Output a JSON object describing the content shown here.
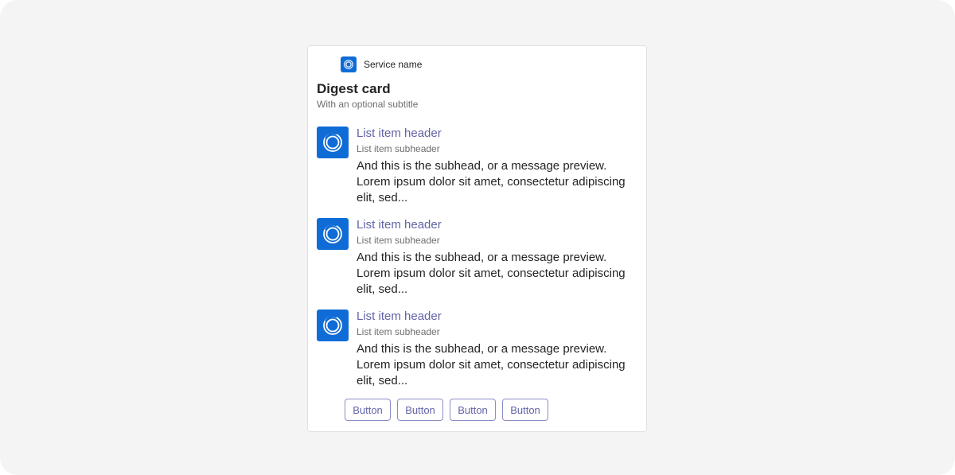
{
  "card": {
    "service_name": "Service name",
    "title": "Digest card",
    "subtitle": "With an optional subtitle",
    "accent_color": "#0f6cd6",
    "link_color": "#6264a7",
    "service_icon": "service-logo-icon",
    "items": [
      {
        "icon": "app-logo-icon",
        "header": "List item header",
        "subheader": "List item subheader",
        "preview": "And this is the subhead, or a message preview. Lorem ipsum dolor sit amet, consectetur adipiscing elit, sed..."
      },
      {
        "icon": "app-logo-icon",
        "header": "List item header",
        "subheader": "List item subheader",
        "preview": "And this is the subhead, or a message preview. Lorem ipsum dolor sit amet, consectetur adipiscing elit, sed..."
      },
      {
        "icon": "app-logo-icon",
        "header": "List item header",
        "subheader": "List item subheader",
        "preview": "And this is the subhead, or a message preview. Lorem ipsum dolor sit amet, consectetur adipiscing elit, sed..."
      }
    ],
    "buttons": [
      "Button",
      "Button",
      "Button",
      "Button"
    ]
  }
}
